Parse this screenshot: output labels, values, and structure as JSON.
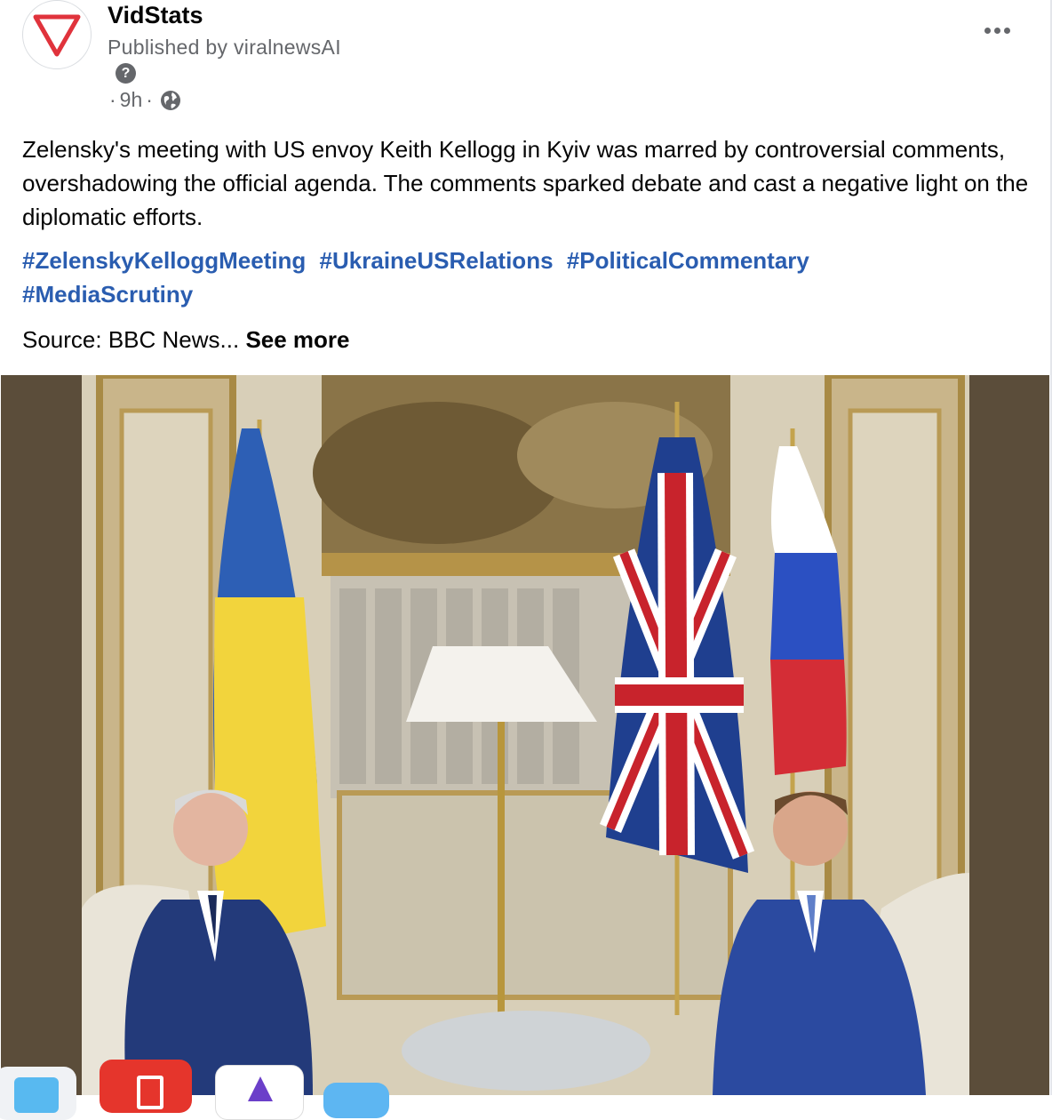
{
  "post": {
    "page_name": "VidStats",
    "published_by": "Published by viralnewsAI",
    "help_glyph": "?",
    "time": "9h",
    "separator": "·",
    "text": "Zelensky's meeting with US envoy Keith Kellogg in Kyiv was marred by controversial comments, overshadowing the official agenda. The comments sparked debate and cast a negative light on the diplomatic efforts.",
    "hashtags": [
      "#ZelenskyKelloggMeeting",
      "#UkraineUSRelations",
      "#PoliticalCommentary",
      "#MediaScrutiny"
    ],
    "source_prefix": "Source: BBC News...",
    "see_more": "See more",
    "icons": {
      "avatar": "vidstats-logo-icon",
      "help": "question-icon",
      "audience": "globe-icon",
      "menu": "more-options-icon"
    },
    "colors": {
      "link": "#2a5db0",
      "secondary_text": "#65676b",
      "logo_red": "#e0333c",
      "image_background": "#5b4d3a"
    }
  },
  "image": {
    "icons": [
      "ukraine-flag",
      "union-jack-flag",
      "russia-flag",
      "lamp"
    ]
  },
  "dock": {
    "icons": [
      "finder-icon",
      "app-red-icon",
      "app-purple-icon",
      "app-blue-icon"
    ]
  }
}
